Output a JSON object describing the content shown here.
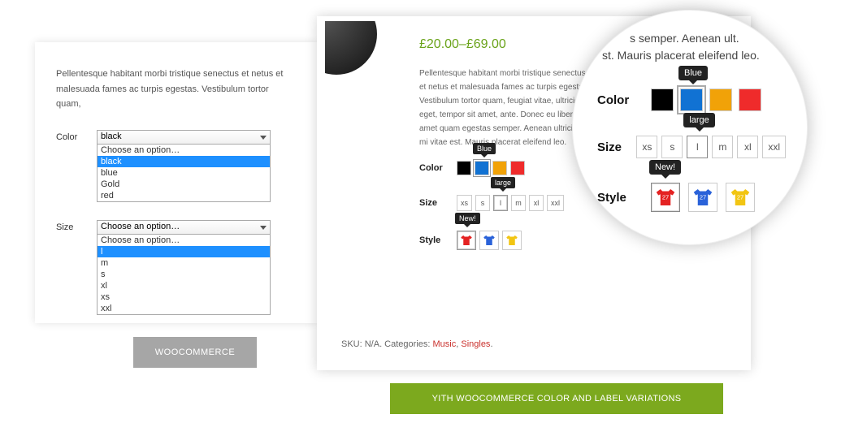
{
  "left": {
    "desc": "Pellentesque habitant morbi tristique senectus et netus et malesuada fames ac turpis egestas. Vestibulum tortor quam,",
    "color_label": "Color",
    "color_selected": "black",
    "color_options": [
      "Choose an option…",
      "black",
      "blue",
      "Gold",
      "red"
    ],
    "size_label": "Size",
    "size_selected": "Choose an option…",
    "size_options": [
      "Choose an option…",
      "l",
      "m",
      "s",
      "xl",
      "xs",
      "xxl"
    ]
  },
  "mid": {
    "price": "£20.00–£69.00",
    "desc": "Pellentesque habitant morbi tristique senectus et netus et malesuada fames ac turpis egestas. Vestibulum tortor quam, feugiat vitae, ultricies eget, tempor sit amet, ante. Donec eu libero sit amet quam egestas semper. Aenean ultricies mi vitae est. Mauris placerat eleifend leo.",
    "color_label": "Color",
    "color_tip": "Blue",
    "colors": [
      "#000000",
      "#1172d3",
      "#f1a208",
      "#ef2b2b"
    ],
    "size_label": "Size",
    "size_tip": "large",
    "sizes": [
      "xs",
      "s",
      "l",
      "m",
      "xl",
      "xxl"
    ],
    "style_label": "Style",
    "style_tip": "New!",
    "styles": [
      "#e42222",
      "#2a62d9",
      "#f2c513"
    ],
    "sku_pre": "SKU: N/A. Categories: ",
    "cat1": "Music",
    "cat2": "Singles"
  },
  "mag": {
    "desc_a": "s semper. Aenean ult.",
    "desc_b": "st. Mauris placerat eleifend leo.",
    "color_label": "Color",
    "color_tip": "Blue",
    "colors": [
      "#000000",
      "#1172d3",
      "#f1a208",
      "#ef2b2b"
    ],
    "size_label": "Size",
    "size_tip": "large",
    "sizes": [
      "xs",
      "s",
      "l",
      "m",
      "xl",
      "xxl"
    ],
    "style_label": "Style",
    "style_tip": "New!",
    "styles": [
      "#e42222",
      "#2a62d9",
      "#f2c513"
    ]
  },
  "badges": {
    "grey": "WOOCOMMERCE",
    "green": "YITH WOOCOMMERCE COLOR AND LABEL VARIATIONS"
  }
}
